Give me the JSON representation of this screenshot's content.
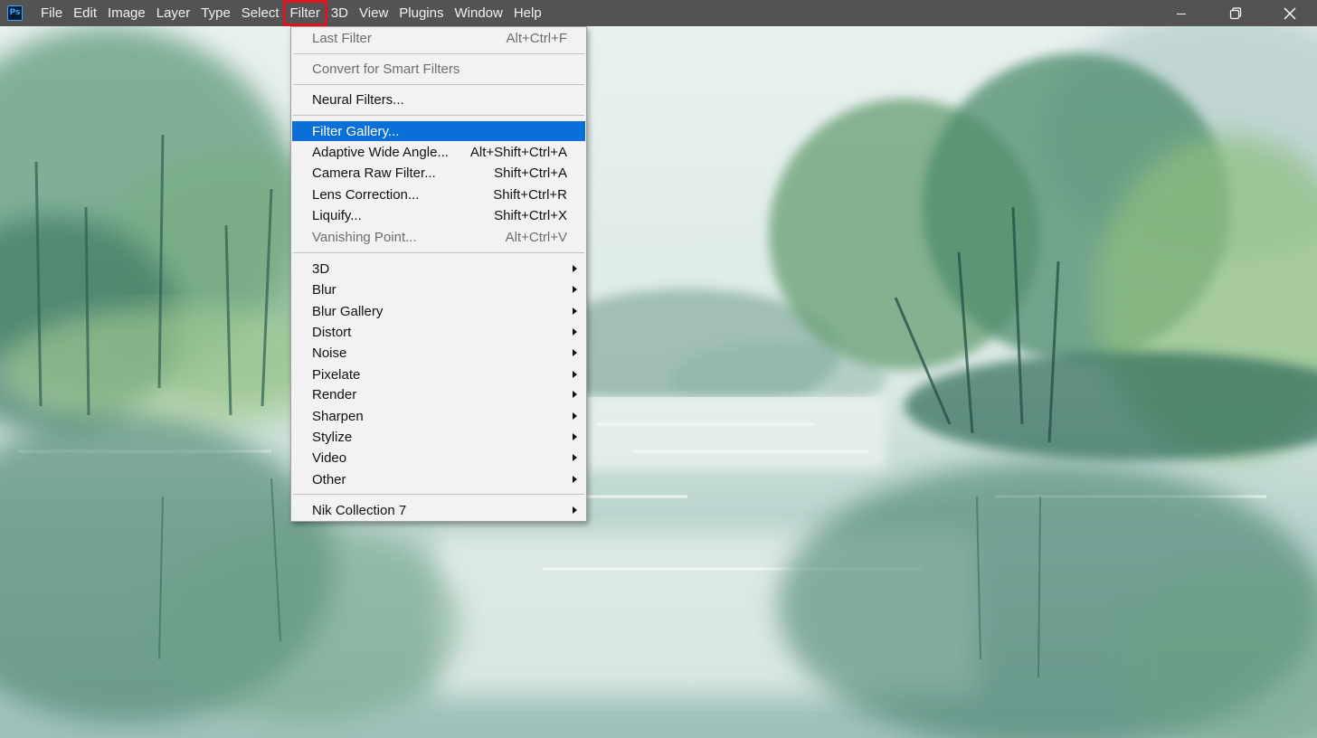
{
  "app": {
    "logo_text": "Ps",
    "logo_color": "#31a8ff"
  },
  "menubar": {
    "items": [
      "File",
      "Edit",
      "Image",
      "Layer",
      "Type",
      "Select",
      "Filter",
      "3D",
      "View",
      "Plugins",
      "Window",
      "Help"
    ],
    "highlighted": "Filter",
    "highlight_color": "#e0141e",
    "background": "#535353"
  },
  "window_controls": [
    "minimize-icon",
    "restore-icon",
    "close-icon"
  ],
  "filter_menu": {
    "selected_color": "#0a6fd8",
    "items": [
      {
        "label": "Last Filter",
        "shortcut": "Alt+Ctrl+F",
        "disabled": true
      },
      {
        "label": "Convert for Smart Filters",
        "disabled": true
      },
      {
        "label": "Neural Filters..."
      },
      {
        "label": "Filter Gallery...",
        "selected": true
      },
      {
        "label": "Adaptive Wide Angle...",
        "shortcut": "Alt+Shift+Ctrl+A"
      },
      {
        "label": "Camera Raw Filter...",
        "shortcut": "Shift+Ctrl+A"
      },
      {
        "label": "Lens Correction...",
        "shortcut": "Shift+Ctrl+R"
      },
      {
        "label": "Liquify...",
        "shortcut": "Shift+Ctrl+X"
      },
      {
        "label": "Vanishing Point...",
        "shortcut": "Alt+Ctrl+V",
        "disabled": true
      },
      {
        "label": "3D",
        "submenu": true
      },
      {
        "label": "Blur",
        "submenu": true
      },
      {
        "label": "Blur Gallery",
        "submenu": true
      },
      {
        "label": "Distort",
        "submenu": true
      },
      {
        "label": "Noise",
        "submenu": true
      },
      {
        "label": "Pixelate",
        "submenu": true
      },
      {
        "label": "Render",
        "submenu": true
      },
      {
        "label": "Sharpen",
        "submenu": true
      },
      {
        "label": "Stylize",
        "submenu": true
      },
      {
        "label": "Video",
        "submenu": true
      },
      {
        "label": "Other",
        "submenu": true
      },
      {
        "label": "Nik Collection 7",
        "submenu": true
      }
    ]
  },
  "canvas": {
    "subject": "watercolor-river-landscape",
    "colors": {
      "sky": "#e4eeec",
      "trees": "#4d8a6a",
      "water": "#c9ddd9",
      "dark": "#2f6457"
    }
  }
}
